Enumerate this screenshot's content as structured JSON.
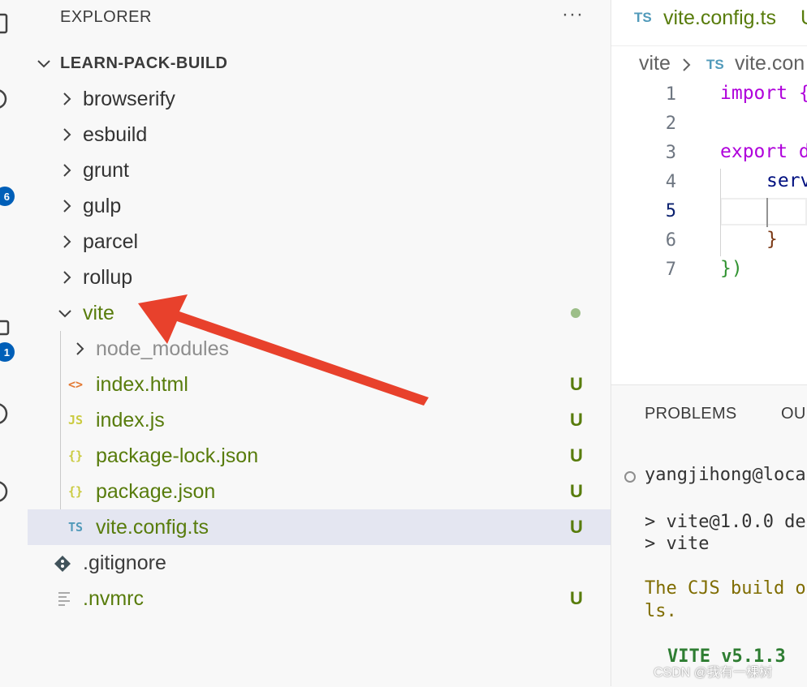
{
  "explorer": {
    "title": "EXPLORER",
    "more_label": "···",
    "project": "LEARN-PACK-BUILD",
    "badges": {
      "source_control": "6",
      "extensions": "1"
    },
    "folders": [
      {
        "name": "browserify"
      },
      {
        "name": "esbuild"
      },
      {
        "name": "grunt"
      },
      {
        "name": "gulp"
      },
      {
        "name": "parcel"
      },
      {
        "name": "rollup"
      }
    ],
    "vite": {
      "name": "vite",
      "children": [
        {
          "name": "node_modules",
          "icon": "chevron",
          "status": ""
        },
        {
          "name": "index.html",
          "icon_text": "<>",
          "status": "U"
        },
        {
          "name": "index.js",
          "icon_text": "JS",
          "status": "U"
        },
        {
          "name": "package-lock.json",
          "icon_text": "{}",
          "status": "U"
        },
        {
          "name": "package.json",
          "icon_text": "{}",
          "status": "U"
        },
        {
          "name": "vite.config.ts",
          "icon_text": "TS",
          "status": "U"
        }
      ]
    },
    "root_files": [
      {
        "name": ".gitignore",
        "status": ""
      },
      {
        "name": ".nvmrc",
        "status": "U"
      }
    ]
  },
  "editor": {
    "tab": {
      "icon_text": "TS",
      "name": "vite.config.ts",
      "status": "U"
    },
    "breadcrumb": {
      "folder": "vite",
      "icon_text": "TS",
      "file": "vite.con"
    },
    "lines": [
      {
        "n": "1",
        "text": "import {"
      },
      {
        "n": "2",
        "text": ""
      },
      {
        "n": "3",
        "text": "export d"
      },
      {
        "n": "4",
        "text": "serv"
      },
      {
        "n": "5",
        "text": ""
      },
      {
        "n": "6",
        "text": "}"
      },
      {
        "n": "7",
        "text": "})"
      }
    ]
  },
  "panel": {
    "tabs": [
      "PROBLEMS",
      "OU"
    ],
    "terminal": {
      "prompt": "yangjihong@loca",
      "line1": "> vite@1.0.0 de",
      "line2": "> vite",
      "warn1": "The CJS build o",
      "warn2": "ls.",
      "vite": "VITE v5.1.3"
    }
  },
  "watermark": "CSDN @我有一棵树",
  "colors": {
    "untracked": "#587c0c",
    "selection": "#e4e6f1",
    "arrow": "#e8412c"
  }
}
